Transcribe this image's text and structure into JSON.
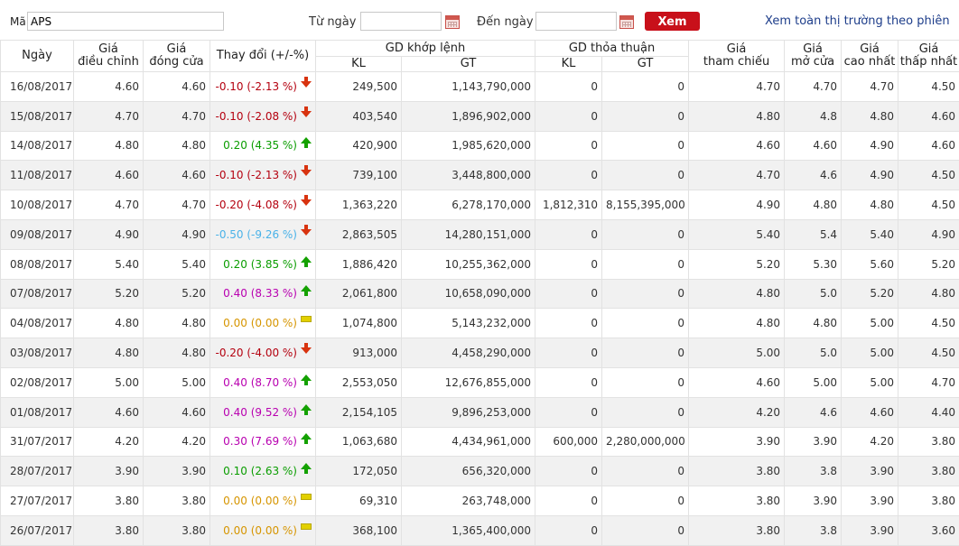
{
  "toolbar": {
    "code_label": "Mã",
    "code_value": "APS",
    "from_label": "Từ ngày",
    "from_value": "",
    "to_label": "Đến ngày",
    "to_value": "",
    "view_button": "Xem",
    "market_link": "Xem toàn thị trường theo phiên"
  },
  "table": {
    "headers": {
      "date": "Ngày",
      "adj_price": [
        "Giá",
        "điều chỉnh"
      ],
      "close_price": [
        "Giá",
        "đóng cửa"
      ],
      "change": "Thay đổi (+/-%)",
      "matched_group": "GD khớp lệnh",
      "matched_kl": "KL",
      "matched_gt": "GT",
      "agreed_group": "GD thỏa thuận",
      "agreed_kl": "KL",
      "agreed_gt": "GT",
      "ref_price": [
        "Giá",
        "tham chiếu"
      ],
      "open_price": [
        "Giá",
        "mở cửa"
      ],
      "high_price": [
        "Giá",
        "cao nhất"
      ],
      "low_price": [
        "Giá",
        "thấp nhất"
      ]
    },
    "colors": {
      "down": "#b4000f",
      "up": "#0a9d00",
      "ceiling": "#b800b0",
      "floor": "#4ab2e8",
      "reference": "#d69500"
    },
    "rows": [
      {
        "date": "16/08/2017",
        "adj": "4.60",
        "close": "4.60",
        "change": "-0.10 (-2.13 %)",
        "trend": "down",
        "kl": "249,500",
        "gt": "1,143,790,000",
        "tt_kl": "0",
        "tt_gt": "0",
        "ref": "4.70",
        "open": "4.70",
        "high": "4.70",
        "low": "4.50"
      },
      {
        "date": "15/08/2017",
        "adj": "4.70",
        "close": "4.70",
        "change": "-0.10 (-2.08 %)",
        "trend": "down",
        "kl": "403,540",
        "gt": "1,896,902,000",
        "tt_kl": "0",
        "tt_gt": "0",
        "ref": "4.80",
        "open": "4.8",
        "high": "4.80",
        "low": "4.60"
      },
      {
        "date": "14/08/2017",
        "adj": "4.80",
        "close": "4.80",
        "change": "0.20 (4.35 %)",
        "trend": "up",
        "kl": "420,900",
        "gt": "1,985,620,000",
        "tt_kl": "0",
        "tt_gt": "0",
        "ref": "4.60",
        "open": "4.60",
        "high": "4.90",
        "low": "4.60"
      },
      {
        "date": "11/08/2017",
        "adj": "4.60",
        "close": "4.60",
        "change": "-0.10 (-2.13 %)",
        "trend": "down",
        "kl": "739,100",
        "gt": "3,448,800,000",
        "tt_kl": "0",
        "tt_gt": "0",
        "ref": "4.70",
        "open": "4.6",
        "high": "4.90",
        "low": "4.50"
      },
      {
        "date": "10/08/2017",
        "adj": "4.70",
        "close": "4.70",
        "change": "-0.20 (-4.08 %)",
        "trend": "down",
        "kl": "1,363,220",
        "gt": "6,278,170,000",
        "tt_kl": "1,812,310",
        "tt_gt": "8,155,395,000",
        "ref": "4.90",
        "open": "4.80",
        "high": "4.80",
        "low": "4.50"
      },
      {
        "date": "09/08/2017",
        "adj": "4.90",
        "close": "4.90",
        "change": "-0.50 (-9.26 %)",
        "trend": "floor",
        "kl": "2,863,505",
        "gt": "14,280,151,000",
        "tt_kl": "0",
        "tt_gt": "0",
        "ref": "5.40",
        "open": "5.4",
        "high": "5.40",
        "low": "4.90"
      },
      {
        "date": "08/08/2017",
        "adj": "5.40",
        "close": "5.40",
        "change": "0.20 (3.85 %)",
        "trend": "up",
        "kl": "1,886,420",
        "gt": "10,255,362,000",
        "tt_kl": "0",
        "tt_gt": "0",
        "ref": "5.20",
        "open": "5.30",
        "high": "5.60",
        "low": "5.20"
      },
      {
        "date": "07/08/2017",
        "adj": "5.20",
        "close": "5.20",
        "change": "0.40 (8.33 %)",
        "trend": "ceiling",
        "kl": "2,061,800",
        "gt": "10,658,090,000",
        "tt_kl": "0",
        "tt_gt": "0",
        "ref": "4.80",
        "open": "5.0",
        "high": "5.20",
        "low": "4.80"
      },
      {
        "date": "04/08/2017",
        "adj": "4.80",
        "close": "4.80",
        "change": "0.00 (0.00 %)",
        "trend": "ref",
        "kl": "1,074,800",
        "gt": "5,143,232,000",
        "tt_kl": "0",
        "tt_gt": "0",
        "ref": "4.80",
        "open": "4.80",
        "high": "5.00",
        "low": "4.50"
      },
      {
        "date": "03/08/2017",
        "adj": "4.80",
        "close": "4.80",
        "change": "-0.20 (-4.00 %)",
        "trend": "down",
        "kl": "913,000",
        "gt": "4,458,290,000",
        "tt_kl": "0",
        "tt_gt": "0",
        "ref": "5.00",
        "open": "5.0",
        "high": "5.00",
        "low": "4.50"
      },
      {
        "date": "02/08/2017",
        "adj": "5.00",
        "close": "5.00",
        "change": "0.40 (8.70 %)",
        "trend": "ceiling",
        "kl": "2,553,050",
        "gt": "12,676,855,000",
        "tt_kl": "0",
        "tt_gt": "0",
        "ref": "4.60",
        "open": "5.00",
        "high": "5.00",
        "low": "4.70"
      },
      {
        "date": "01/08/2017",
        "adj": "4.60",
        "close": "4.60",
        "change": "0.40 (9.52 %)",
        "trend": "ceiling",
        "kl": "2,154,105",
        "gt": "9,896,253,000",
        "tt_kl": "0",
        "tt_gt": "0",
        "ref": "4.20",
        "open": "4.6",
        "high": "4.60",
        "low": "4.40"
      },
      {
        "date": "31/07/2017",
        "adj": "4.20",
        "close": "4.20",
        "change": "0.30 (7.69 %)",
        "trend": "ceiling",
        "kl": "1,063,680",
        "gt": "4,434,961,000",
        "tt_kl": "600,000",
        "tt_gt": "2,280,000,000",
        "ref": "3.90",
        "open": "3.90",
        "high": "4.20",
        "low": "3.80"
      },
      {
        "date": "28/07/2017",
        "adj": "3.90",
        "close": "3.90",
        "change": "0.10 (2.63 %)",
        "trend": "up",
        "kl": "172,050",
        "gt": "656,320,000",
        "tt_kl": "0",
        "tt_gt": "0",
        "ref": "3.80",
        "open": "3.8",
        "high": "3.90",
        "low": "3.80"
      },
      {
        "date": "27/07/2017",
        "adj": "3.80",
        "close": "3.80",
        "change": "0.00 (0.00 %)",
        "trend": "ref",
        "kl": "69,310",
        "gt": "263,748,000",
        "tt_kl": "0",
        "tt_gt": "0",
        "ref": "3.80",
        "open": "3.90",
        "high": "3.90",
        "low": "3.80"
      },
      {
        "date": "26/07/2017",
        "adj": "3.80",
        "close": "3.80",
        "change": "0.00 (0.00 %)",
        "trend": "ref",
        "kl": "368,100",
        "gt": "1,365,400,000",
        "tt_kl": "0",
        "tt_gt": "0",
        "ref": "3.80",
        "open": "3.8",
        "high": "3.90",
        "low": "3.60"
      }
    ]
  }
}
